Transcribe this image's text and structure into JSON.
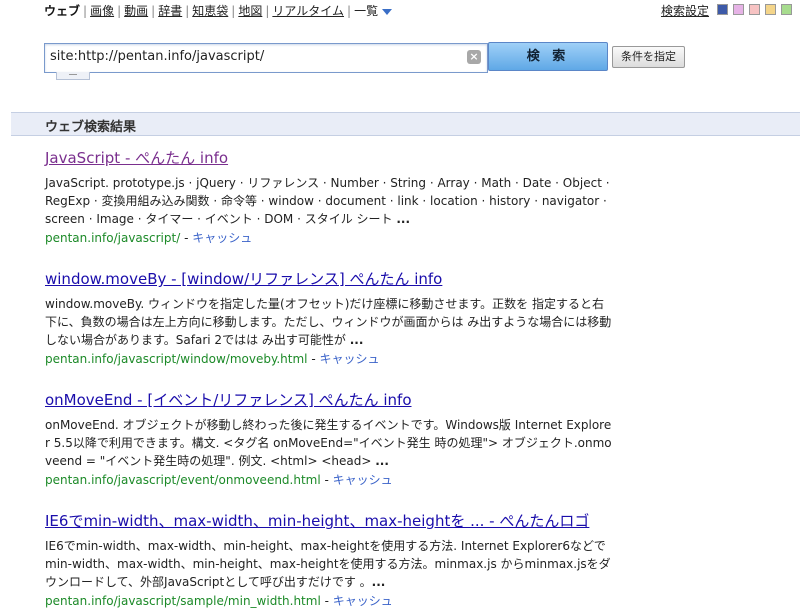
{
  "nav": {
    "items": [
      "ウェブ",
      "画像",
      "動画",
      "辞書",
      "知恵袋",
      "地図",
      "リアルタイム"
    ],
    "more": "一覧",
    "active_index": 0,
    "settings": "検索設定",
    "swatch_colors": [
      "#3d5aa8",
      "#e6b3e6",
      "#f7c3c3",
      "#f4d58a",
      "#a7dc8e"
    ]
  },
  "search": {
    "query": "site:http://pentan.info/javascript/",
    "clear_icon": "×",
    "button": "検 索",
    "conditions": "条件を指定"
  },
  "results_header": "ウェブ検索結果",
  "results": [
    {
      "title": "JavaScript - ぺんたん info",
      "snippet": "JavaScript. prototype.js · jQuery · リファレンス · Number · String · Array · Math · Date · Object · RegExp · 変換用組み込み関数 · 命令等 · window · document · link · location · history · navigator · screen · Image · タイマー · イベント · DOM · スタイル シート ",
      "ellipsis": "...",
      "url": "pentan.info/javascript/",
      "cache": "キャッシュ"
    },
    {
      "title": "window.moveBy - [window/リファレンス] ぺんたん info",
      "snippet": "window.moveBy. ウィンドウを指定した量(オフセット)だけ座標に移動させます。正数を 指定すると右下に、負数の場合は左上方向に移動します。ただし、ウィンドウが画面からは み出すような場合には移動しない場合があります。Safari 2ではは み出す可能性が ",
      "ellipsis": "...",
      "url": "pentan.info/javascript/window/moveby.html",
      "cache": "キャッシュ"
    },
    {
      "title": "onMoveEnd - [イベント/リファレンス] ぺんたん info",
      "snippet": "onMoveEnd. オブジェクトが移動し終わった後に発生するイベントです。Windows版 Internet Explorer 5.5以降で利用できます。構文. <タグ名 onMoveEnd=\"イベント発生 時の処理\"> オブジェクト.onmoveend = \"イベント発生時の処理\". 例文. <html> <head> ",
      "ellipsis": "...",
      "url": "pentan.info/javascript/event/onmoveend.html",
      "cache": "キャッシュ"
    },
    {
      "title": "IE6でmin-width、max-width、min-height、max-heightを ... - ぺんたんロゴ",
      "snippet": "IE6でmin-width、max-width、min-height、max-heightを使用する方法. Internet Explorer6などでmin-width、max-width、min-height、max-heightを使用する方法。minmax.js からminmax.jsをダウンロードして、外部JavaScriptとして呼び出すだけです 。",
      "ellipsis": "...",
      "url": "pentan.info/javascript/sample/min_width.html",
      "cache": "キャッシュ"
    }
  ]
}
